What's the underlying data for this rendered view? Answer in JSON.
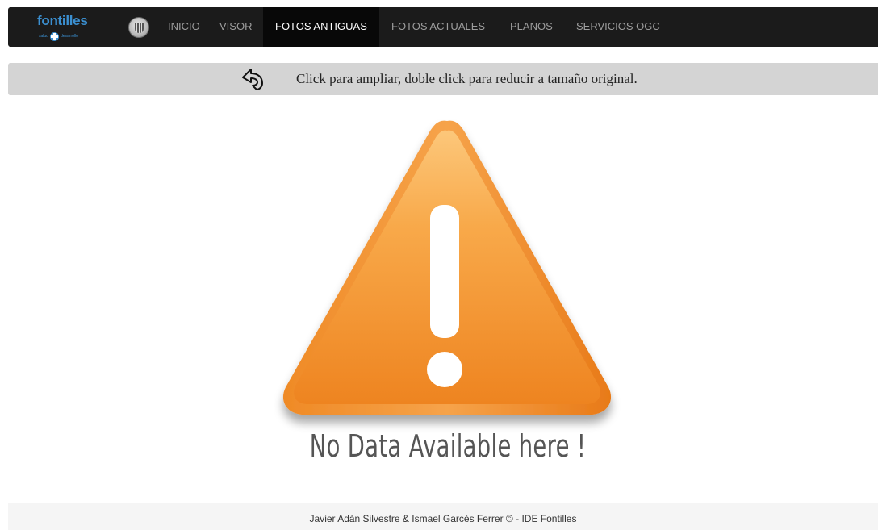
{
  "header": {
    "brand": {
      "name": "fontilles",
      "tagline_left": "salud",
      "tagline_right": "desarrollo"
    },
    "nav": [
      {
        "label": "INICIO",
        "active": false
      },
      {
        "label": "VISOR",
        "active": false
      },
      {
        "label": "FOTOS ANTIGUAS",
        "active": true
      },
      {
        "label": "FOTOS ACTUALES",
        "active": false
      },
      {
        "label": "PLANOS",
        "active": false
      },
      {
        "label": "SERVICIOS OGC",
        "active": false
      }
    ]
  },
  "toolbar": {
    "back_icon": "curved-back-arrow-icon",
    "instruction": "Click para ampliar, doble click para reducir a tamaño original."
  },
  "main": {
    "image_icon": "warning-triangle-icon",
    "image_caption": "No Data Available here !"
  },
  "footer": {
    "text": "Javier Adán Silvestre & Ismael Garcés Ferrer © - IDE Fontilles"
  },
  "colors": {
    "navbar": "#1b1b1b",
    "nav_active": "#080808",
    "brand_blue": "#3b8fd0",
    "warning_orange": "#f0891f",
    "toolbar_bg": "#d4d4d4"
  }
}
